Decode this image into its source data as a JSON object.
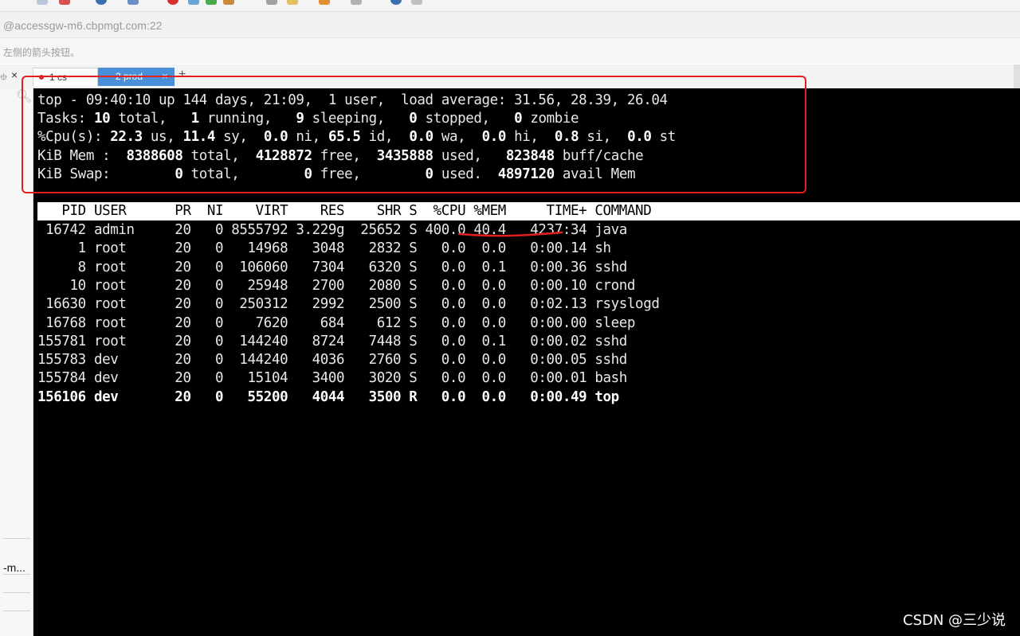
{
  "window": {
    "address": "@accessgw-m6.cbpmgt.com:22",
    "hint": "左侧的箭头按钮。"
  },
  "tabs": [
    {
      "label": "1 cs"
    },
    {
      "label": "2 prod"
    }
  ],
  "sidebar": {
    "item": "-m..."
  },
  "summary": [
    [
      [
        "top - 09:40:10 up 144 days, 21:09,  1 user,  load average: 31.56, 28.39, 26.04",
        false
      ]
    ],
    [
      [
        "Tasks: ",
        false
      ],
      [
        "10",
        true
      ],
      [
        " total,   ",
        false
      ],
      [
        "1",
        true
      ],
      [
        " running,   ",
        false
      ],
      [
        "9",
        true
      ],
      [
        " sleeping,   ",
        false
      ],
      [
        "0",
        true
      ],
      [
        " stopped,   ",
        false
      ],
      [
        "0",
        true
      ],
      [
        " zombie",
        false
      ]
    ],
    [
      [
        "%Cpu(s): ",
        false
      ],
      [
        "22.3",
        true
      ],
      [
        " us, ",
        false
      ],
      [
        "11.4",
        true
      ],
      [
        " sy,  ",
        false
      ],
      [
        "0.0",
        true
      ],
      [
        " ni, ",
        false
      ],
      [
        "65.5",
        true
      ],
      [
        " id,  ",
        false
      ],
      [
        "0.0",
        true
      ],
      [
        " wa,  ",
        false
      ],
      [
        "0.0",
        true
      ],
      [
        " hi,  ",
        false
      ],
      [
        "0.8",
        true
      ],
      [
        " si,  ",
        false
      ],
      [
        "0.0",
        true
      ],
      [
        " st",
        false
      ]
    ],
    [
      [
        "KiB Mem :  ",
        false
      ],
      [
        "8388608",
        true
      ],
      [
        " total,  ",
        false
      ],
      [
        "4128872",
        true
      ],
      [
        " free,  ",
        false
      ],
      [
        "3435888",
        true
      ],
      [
        " used,   ",
        false
      ],
      [
        "823848",
        true
      ],
      [
        " buff/cache",
        false
      ]
    ],
    [
      [
        "KiB Swap:        ",
        false
      ],
      [
        "0",
        true
      ],
      [
        " total,        ",
        false
      ],
      [
        "0",
        true
      ],
      [
        " free,        ",
        false
      ],
      [
        "0",
        true
      ],
      [
        " used.  ",
        false
      ],
      [
        "4897120",
        true
      ],
      [
        " avail Mem",
        false
      ]
    ]
  ],
  "process_table": {
    "header": "   PID USER      PR  NI    VIRT    RES    SHR S  %CPU %MEM     TIME+ COMMAND",
    "rows": [
      {
        "text": " 16742 admin     20   0 8555792 3.229g  25652 S 400.0 40.4   4237:34 java",
        "bold": false
      },
      {
        "text": "     1 root      20   0   14968   3048   2832 S   0.0  0.0   0:00.14 sh",
        "bold": false
      },
      {
        "text": "     8 root      20   0  106060   7304   6320 S   0.0  0.1   0:00.36 sshd",
        "bold": false
      },
      {
        "text": "    10 root      20   0   25948   2700   2080 S   0.0  0.0   0:00.10 crond",
        "bold": false
      },
      {
        "text": " 16630 root      20   0  250312   2992   2500 S   0.0  0.0   0:02.13 rsyslogd",
        "bold": false
      },
      {
        "text": " 16768 root      20   0    7620    684    612 S   0.0  0.0   0:00.00 sleep",
        "bold": false
      },
      {
        "text": "155781 root      20   0  144240   8724   7448 S   0.0  0.1   0:00.02 sshd",
        "bold": false
      },
      {
        "text": "155783 dev       20   0  144240   4036   2760 S   0.0  0.0   0:00.05 sshd",
        "bold": false
      },
      {
        "text": "155784 dev       20   0   15104   3400   3020 S   0.0  0.0   0:00.01 bash",
        "bold": false
      },
      {
        "text": "156106 dev       20   0   55200   4044   3500 R   0.0  0.0   0:00.49 top",
        "bold": true
      }
    ]
  },
  "watermark": "CSDN @三少说",
  "colors": {
    "terminal_bg": "#000000",
    "annotation_red": "#e02020",
    "active_tab": "#4a90d9"
  }
}
